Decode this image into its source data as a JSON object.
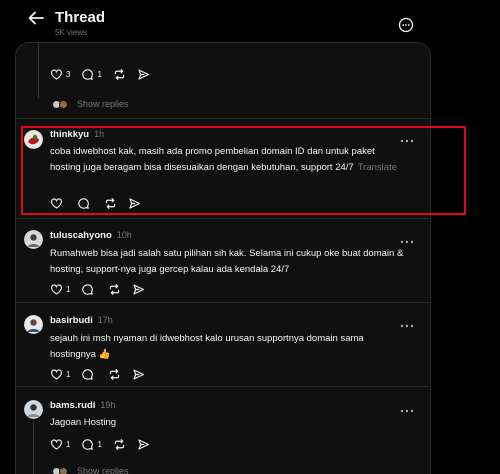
{
  "header": {
    "title": "Thread",
    "subtitle": "5K views"
  },
  "top_post": {
    "likes": "3",
    "replies": "1",
    "show_replies": "Show replies"
  },
  "replies": [
    {
      "username": "thinkkyu",
      "time": "1h",
      "text": "coba idwebhost kak, masih ada promo pembelian domain ID dan untuk paket hosting juga beragam bisa disesuaikan dengan kebutuhan, support 24/7",
      "translate": "Translate",
      "likes": "",
      "replies": ""
    },
    {
      "username": "tuluscahyono",
      "time": "10h",
      "text": "Rumahweb bisa jadi salah satu pilihan sih kak. Selama ini cukup oke buat domain & hosting, support-nya juga gercep kalau ada kendala 24/7",
      "likes": "1",
      "replies": ""
    },
    {
      "username": "basirbudi",
      "time": "17h",
      "text": "sejauh ini msh nyaman di idwebhost kalo urusan supportnya domain sama hostingnya 👍",
      "likes": "1",
      "replies": ""
    },
    {
      "username": "bams.rudi",
      "time": "19h",
      "text": "Jagoan Hosting",
      "likes": "1",
      "replies": "1",
      "show_replies": "Show replies"
    }
  ],
  "colors": {
    "background": "#000000",
    "panel": "#101010",
    "text": "#f3f5f7",
    "muted": "#777777",
    "highlight_border": "#e0071f"
  }
}
